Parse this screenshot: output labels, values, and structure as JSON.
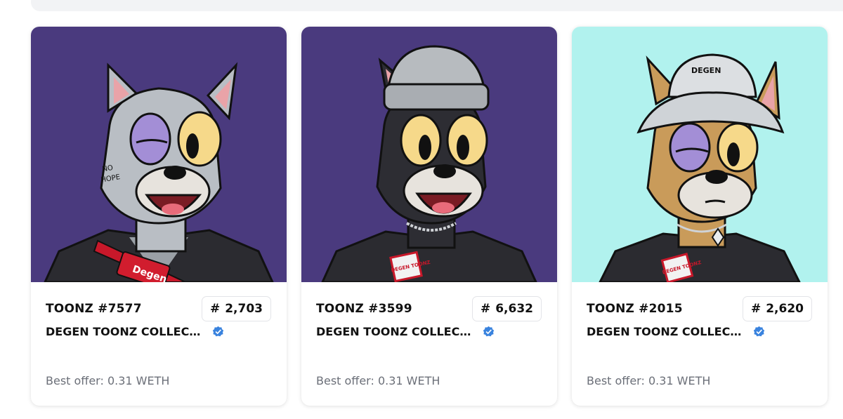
{
  "colors": {
    "purple_bg": "#4a3a7e",
    "aqua_bg": "#b1f2ee",
    "verified_blue": "#3a83de",
    "muted_text": "#6b6f78"
  },
  "cards": [
    {
      "name": "TOONZ #7577",
      "rank_symbol": "#",
      "rank_value": "2,703",
      "collection": "DEGEN TOONZ COLLECTI...",
      "best_offer": "Best offer: 0.31 WETH",
      "background": "purple",
      "hat": "none",
      "bag_text": "Degen"
    },
    {
      "name": "TOONZ #3599",
      "rank_symbol": "#",
      "rank_value": "6,632",
      "collection": "DEGEN TOONZ COLLECTI...",
      "best_offer": "Best offer: 0.31 WETH",
      "background": "purple",
      "hat": "beanie",
      "patch_text": "DEGEN TOONZ"
    },
    {
      "name": "TOONZ #2015",
      "rank_symbol": "#",
      "rank_value": "2,620",
      "collection": "DEGEN TOONZ COLLECTI...",
      "best_offer": "Best offer: 0.31 WETH",
      "background": "aqua",
      "hat": "bucket",
      "hat_text": "DEGEN",
      "patch_text": "DEGEN TOONZ"
    }
  ]
}
